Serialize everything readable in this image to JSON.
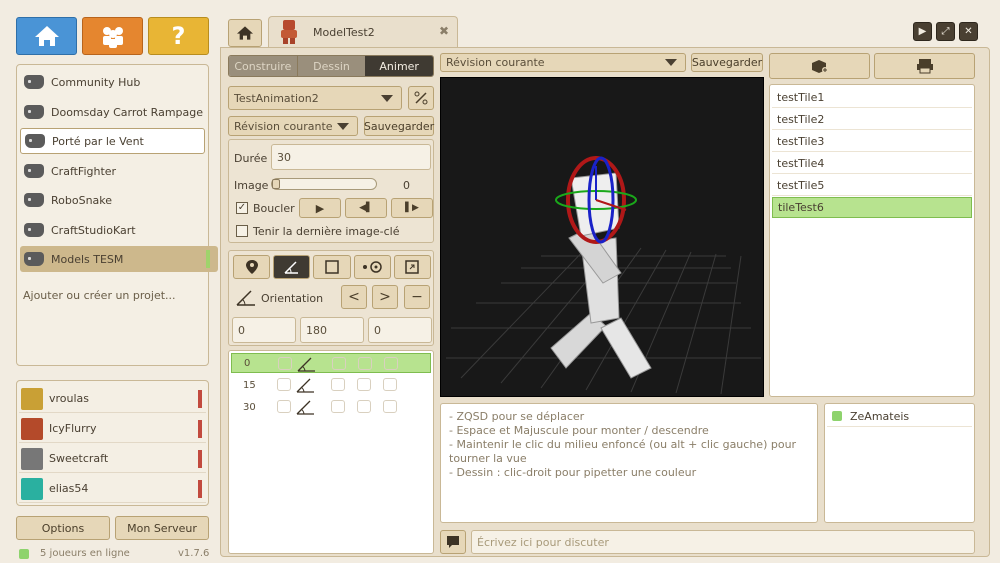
{
  "top_nav": {
    "home": "home-icon",
    "community": "community-icon",
    "help": "?"
  },
  "projects": [
    {
      "name": "Community Hub"
    },
    {
      "name": "Doomsday Carrot Rampage"
    },
    {
      "name": "Porté par le Vent"
    },
    {
      "name": "CraftFighter"
    },
    {
      "name": "RoboSnake"
    },
    {
      "name": "CraftStudioKart"
    },
    {
      "name": "Models TESM"
    }
  ],
  "add_project": "Ajouter ou créer un projet...",
  "users": [
    {
      "name": "vroulas"
    },
    {
      "name": "IcyFlurry"
    },
    {
      "name": "Sweetcraft"
    },
    {
      "name": "elias54"
    }
  ],
  "bottom": {
    "options": "Options",
    "server": "Mon Serveur",
    "online": "5 joueurs en ligne",
    "version": "v1.7.6"
  },
  "tab": {
    "title": "ModelTest2",
    "close": "✖"
  },
  "window_controls": [
    "▶",
    "⤢",
    "✕"
  ],
  "modes": {
    "build": "Construire",
    "draw": "Dessin",
    "animate": "Animer"
  },
  "animation": {
    "selected": "TestAnimation2",
    "revision": "Révision courante",
    "save": "Sauvegarder"
  },
  "props": {
    "duration_label": "Durée",
    "duration_value": "30",
    "image_label": "Image",
    "image_value": "0",
    "loop_label": "Boucler",
    "hold_label": "Tenir la dernière image-clé"
  },
  "transform": {
    "label": "Orientation",
    "values": [
      "0",
      "180",
      "0"
    ]
  },
  "timeline": [
    {
      "frame": "0",
      "active": true
    },
    {
      "frame": "15",
      "active": false
    },
    {
      "frame": "30",
      "active": false
    }
  ],
  "viewport": {
    "revision": "Révision courante",
    "save": "Sauvegarder"
  },
  "tiles": [
    "testTile1",
    "testTile2",
    "testTile3",
    "testTile4",
    "testTile5",
    "tileTest6"
  ],
  "help_lines": [
    "- ZQSD pour se déplacer",
    "- Espace et Majuscule pour monter / descendre",
    "- Maintenir le clic du milieu enfoncé (ou alt + clic gauche) pour tourner la vue",
    "- Dessin : clic-droit pour pipetter une couleur"
  ],
  "participants": [
    "ZeAmateis"
  ],
  "chat": {
    "placeholder": "Écrivez ici pour discuter"
  },
  "colors": {
    "accent_green": "#b7e38f",
    "blue": "#4a94d6",
    "orange": "#e5862f",
    "yellow": "#e8b535",
    "bg": "#e9dfcc"
  }
}
